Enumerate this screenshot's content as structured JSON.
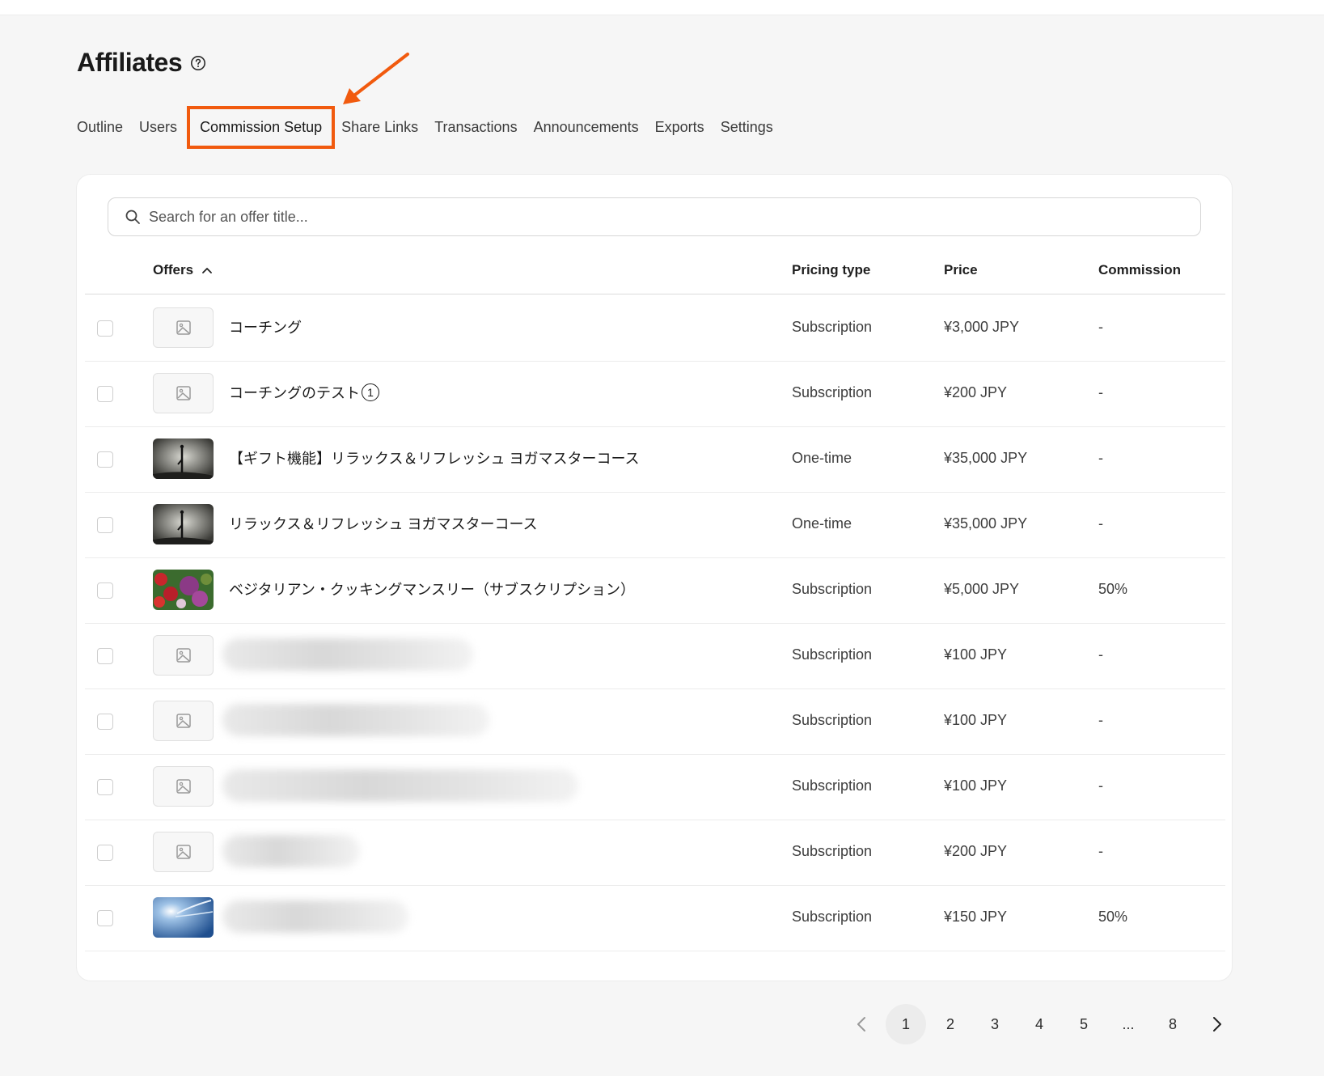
{
  "header": {
    "title": "Affiliates"
  },
  "tabs": [
    {
      "label": "Outline",
      "active": false
    },
    {
      "label": "Users",
      "active": false
    },
    {
      "label": "Commission Setup",
      "active": true
    },
    {
      "label": "Share Links",
      "active": false
    },
    {
      "label": "Transactions",
      "active": false
    },
    {
      "label": "Announcements",
      "active": false
    },
    {
      "label": "Exports",
      "active": false
    },
    {
      "label": "Settings",
      "active": false
    }
  ],
  "search": {
    "placeholder": "Search for an offer title..."
  },
  "table": {
    "columns": {
      "offers": "Offers",
      "pricing_type": "Pricing type",
      "price": "Price",
      "commission": "Commission"
    },
    "rows": [
      {
        "title": "コーチング",
        "pricing": "Subscription",
        "price": "¥3,000 JPY",
        "commission": "-",
        "thumb": "placeholder"
      },
      {
        "title": "コーチングのテスト",
        "badge": "1",
        "pricing": "Subscription",
        "price": "¥200 JPY",
        "commission": "-",
        "thumb": "placeholder"
      },
      {
        "title": "【ギフト機能】リラックス＆リフレッシュ ヨガマスターコース",
        "pricing": "One-time",
        "price": "¥35,000 JPY",
        "commission": "-",
        "thumb": "yoga"
      },
      {
        "title": "リラックス＆リフレッシュ ヨガマスターコース",
        "pricing": "One-time",
        "price": "¥35,000 JPY",
        "commission": "-",
        "thumb": "yoga"
      },
      {
        "title": "ベジタリアン・クッキングマンスリー（サブスクリプション）",
        "pricing": "Subscription",
        "price": "¥5,000 JPY",
        "commission": "50%",
        "thumb": "vegetables"
      },
      {
        "title": "",
        "pricing": "Subscription",
        "price": "¥100 JPY",
        "commission": "-",
        "thumb": "placeholder"
      },
      {
        "title": "",
        "pricing": "Subscription",
        "price": "¥100 JPY",
        "commission": "-",
        "thumb": "placeholder"
      },
      {
        "title": "",
        "pricing": "Subscription",
        "price": "¥100 JPY",
        "commission": "-",
        "thumb": "placeholder"
      },
      {
        "title": "",
        "pricing": "Subscription",
        "price": "¥200 JPY",
        "commission": "-",
        "thumb": "placeholder"
      },
      {
        "title": "",
        "pricing": "Subscription",
        "price": "¥150 JPY",
        "commission": "50%",
        "thumb": "sky"
      }
    ]
  },
  "pagination": {
    "pages": [
      "1",
      "2",
      "3",
      "4",
      "5",
      "...",
      "8"
    ],
    "current": "1"
  },
  "colors": {
    "accent": "#f15a0e"
  }
}
